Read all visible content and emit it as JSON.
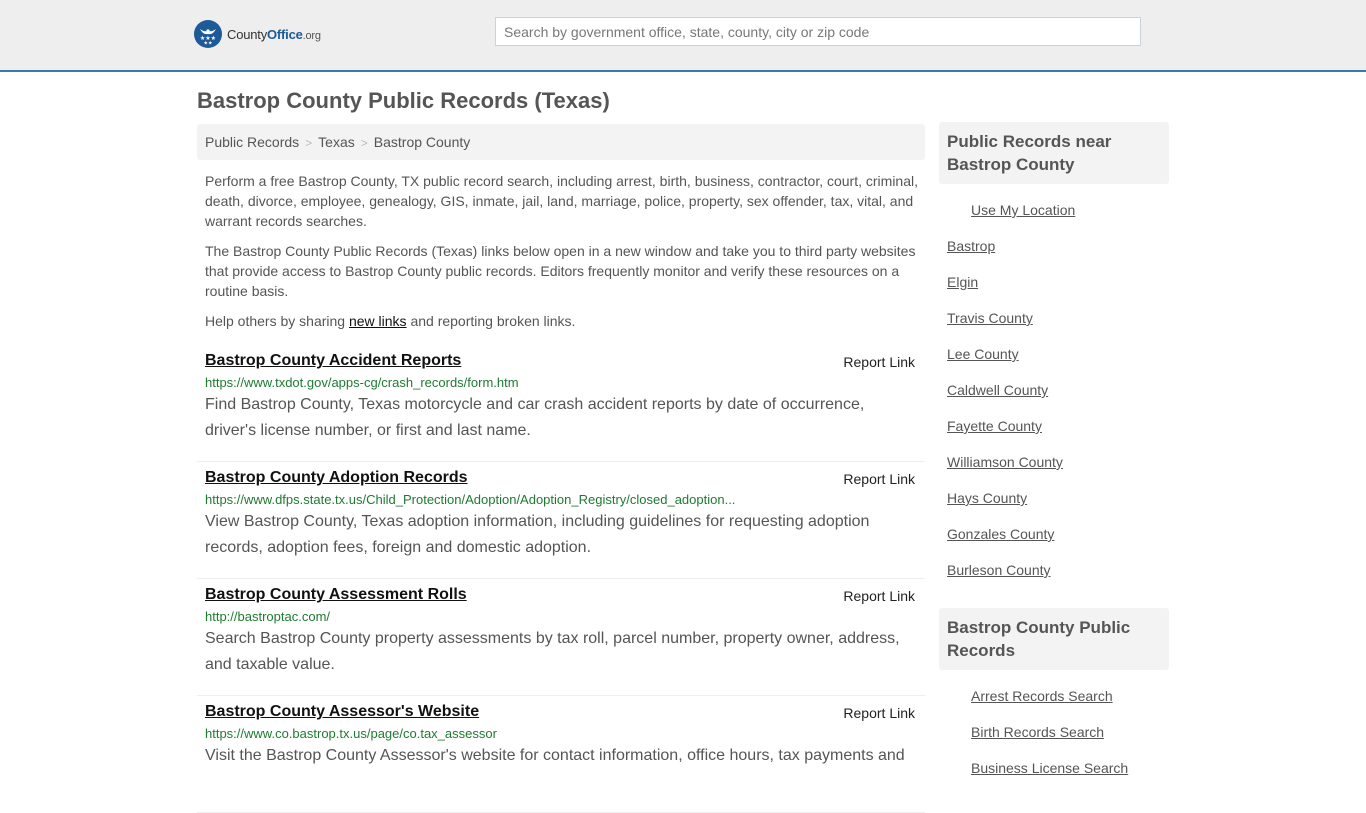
{
  "header": {
    "logo": {
      "brand_main": "County",
      "brand_accent": "Office",
      "brand_tld": ".org",
      "icon": "eagle-stars-badge-icon"
    },
    "search": {
      "placeholder": "Search by government office, state, county, city or zip code",
      "value": ""
    }
  },
  "page": {
    "title": "Bastrop County Public Records (Texas)",
    "breadcrumb": [
      "Public Records",
      "Texas",
      "Bastrop County"
    ],
    "intro": {
      "p1": "Perform a free Bastrop County, TX public record search, including arrest, birth, business, contractor, court, criminal, death, divorce, employee, genealogy, GIS, inmate, jail, land, marriage, police, property, sex offender, tax, vital, and warrant records searches.",
      "p2": "The Bastrop County Public Records (Texas) links below open in a new window and take you to third party websites that provide access to Bastrop County public records. Editors frequently monitor and verify these resources on a routine basis.",
      "p3_before": "Help others by sharing ",
      "p3_link": "new links",
      "p3_after": " and reporting broken links."
    },
    "results": [
      {
        "title": "Bastrop County Accident Reports",
        "report_label": "Report Link",
        "url": "https://www.txdot.gov/apps-cg/crash_records/form.htm",
        "description": "Find Bastrop County, Texas motorcycle and car crash accident reports by date of occurrence, driver's license number, or first and last name."
      },
      {
        "title": "Bastrop County Adoption Records",
        "report_label": "Report Link",
        "url": "https://www.dfps.state.tx.us/Child_Protection/Adoption/Adoption_Registry/closed_adoption...",
        "description": "View Bastrop County, Texas adoption information, including guidelines for requesting adoption records, adoption fees, foreign and domestic adoption."
      },
      {
        "title": "Bastrop County Assessment Rolls",
        "report_label": "Report Link",
        "url": "http://bastroptac.com/",
        "description": "Search Bastrop County property assessments by tax roll, parcel number, property owner, address, and taxable value."
      },
      {
        "title": "Bastrop County Assessor's Website",
        "report_label": "Report Link",
        "url": "https://www.co.bastrop.tx.us/page/co.tax_assessor",
        "description": "Visit the Bastrop County Assessor's website for contact information, office hours, tax payments and"
      }
    ]
  },
  "sidebar": {
    "near": {
      "heading": "Public Records near Bastrop County",
      "use_location": "Use My Location",
      "places": [
        "Bastrop",
        "Elgin",
        "Travis County",
        "Lee County",
        "Caldwell County",
        "Fayette County",
        "Williamson County",
        "Hays County",
        "Gonzales County",
        "Burleson County"
      ]
    },
    "records": {
      "heading": "Bastrop County Public Records",
      "items": [
        "Arrest Records Search",
        "Birth Records Search",
        "Business License Search"
      ]
    }
  }
}
